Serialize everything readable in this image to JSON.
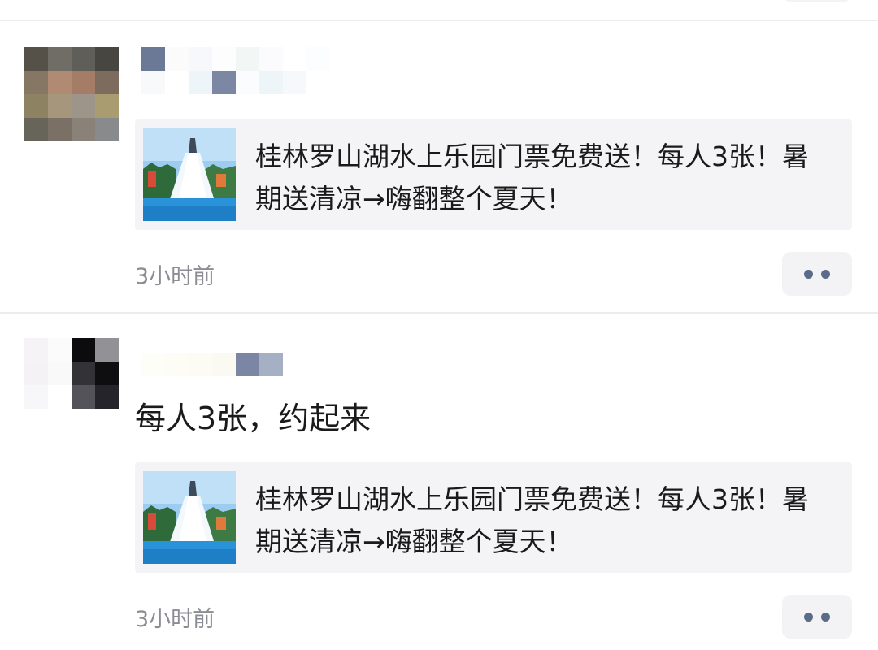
{
  "feed": {
    "posts": [
      {
        "share": {
          "title": "桂林罗山湖水上乐园门票免费送！每人3张！暑期送清凉→嗨翻整个夏天！",
          "thumbnail_icon": "water-park-photo"
        },
        "time": "3小时前",
        "more_icon": "more-dots-icon"
      },
      {
        "text": "每人3张，约起来",
        "share": {
          "title": "桂林罗山湖水上乐园门票免费送！每人3张！暑期送清凉→嗨翻整个夏天！",
          "thumbnail_icon": "water-park-photo"
        },
        "time": "3小时前",
        "more_icon": "more-dots-icon"
      }
    ]
  }
}
